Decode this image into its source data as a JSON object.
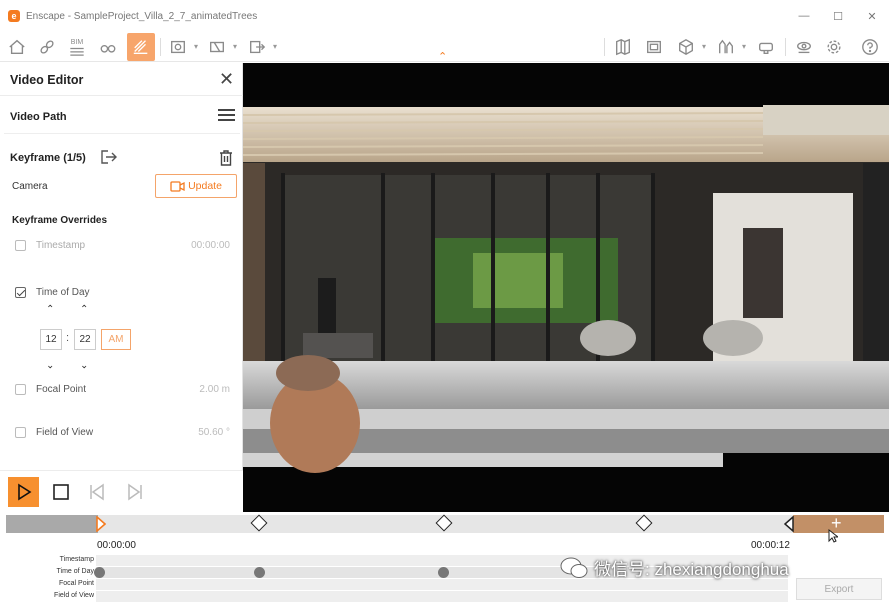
{
  "window": {
    "title": "Enscape - SampleProject_Villa_2_7_animatedTrees",
    "logo_letter": "e"
  },
  "toolbar": {
    "icons": [
      "home-icon",
      "link-icon",
      "bim-icon",
      "binoculars-icon",
      "video-editor-icon",
      "screenshot-icon",
      "batch-render-icon",
      "export-icon",
      "map-icon",
      "asset-library-icon",
      "material-icon",
      "site-context-icon",
      "vr-headset-icon",
      "view-icon",
      "settings-icon",
      "help-icon"
    ],
    "bim_label": "BIM",
    "accent": "#f47b20"
  },
  "panel": {
    "title": "Video Editor",
    "video_path_label": "Video Path",
    "keyframe_label": "Keyframe (1/5)",
    "camera_label": "Camera",
    "update_label": "Update",
    "overrides_label": "Keyframe Overrides",
    "overrides": [
      {
        "label": "Timestamp",
        "value": "00:00:00",
        "checked": false
      },
      {
        "label": "Time of Day",
        "value": "",
        "checked": true
      },
      {
        "label": "Focal Point",
        "value": "2.00 m",
        "checked": false
      },
      {
        "label": "Field of View",
        "value": "50.60 °",
        "checked": false
      }
    ],
    "time_of_day": {
      "hour": "12",
      "minute": "22",
      "ampm": "AM",
      "separator": ":"
    }
  },
  "timeline": {
    "start_time": "00:00:00",
    "end_time": "00:00:12",
    "subtracks": [
      "Timestamp",
      "Time of Day",
      "Focal Point",
      "Field of View"
    ],
    "export_label": "Export",
    "add_label": "+",
    "watermark": "微信号: zhexiangdonghua"
  }
}
